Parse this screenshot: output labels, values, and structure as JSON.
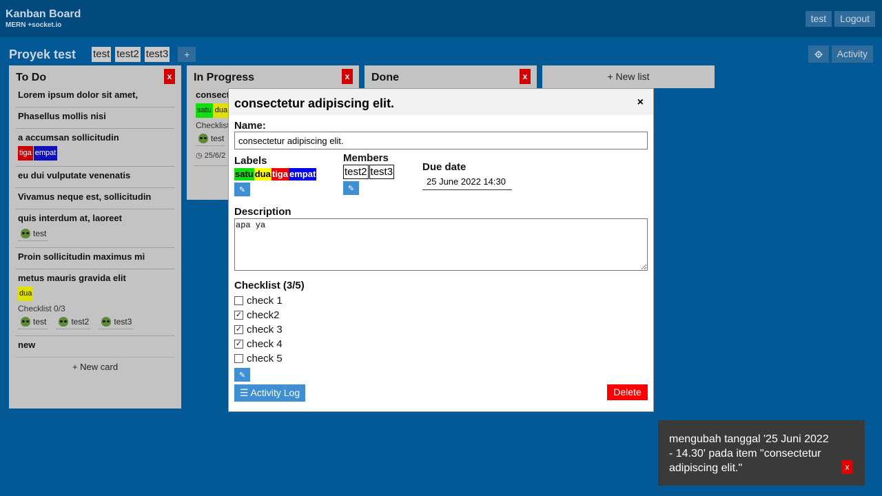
{
  "header": {
    "title": "Kanban Board",
    "subtitle": "MERN +socket.io",
    "user_label": "test",
    "logout_label": "Logout"
  },
  "project": {
    "title": "Proyek test",
    "tabs": [
      "test",
      "test2",
      "test3"
    ],
    "add_label": "+",
    "settings_icon": "gear-icon",
    "activity_label": "Activity"
  },
  "lists": [
    {
      "title": "To Do",
      "close_label": "x",
      "cards": [
        {
          "title": "Lorem ipsum dolor sit amet,"
        },
        {
          "title": "Phasellus mollis nisi"
        },
        {
          "title": "a accumsan sollicitudin",
          "labels": [
            "tiga",
            "empat"
          ]
        },
        {
          "title": "eu dui vulputate venenatis"
        },
        {
          "title": "Vivamus neque est, sollicitudin"
        },
        {
          "title": "quis interdum at, laoreet",
          "members": [
            "test"
          ]
        },
        {
          "title": "Proin sollicitudin maximus mi"
        },
        {
          "title": "metus mauris gravida elit",
          "labels": [
            "dua"
          ],
          "checklist": "Checklist 0/3",
          "members": [
            "test",
            "test2",
            "test3"
          ]
        },
        {
          "title": "new"
        }
      ],
      "new_card_label": "+ New card"
    },
    {
      "title": "In Progress",
      "close_label": "x",
      "card_title": "consect",
      "labels": [
        "satu",
        "dua"
      ],
      "checklist": "Checklist",
      "member": "test",
      "date": "25/6/2"
    },
    {
      "title": "Done",
      "close_label": "x"
    }
  ],
  "new_list_label": "+ New list",
  "modal": {
    "title": "consectetur adipiscing elit.",
    "close_label": "×",
    "name_label": "Name:",
    "name_value": "consectetur adipiscing elit.",
    "labels_label": "Labels",
    "labels": [
      "satu",
      "dua",
      "tiga",
      "empat"
    ],
    "members_label": "Members",
    "members": [
      "test2",
      "test3"
    ],
    "due_label": "Due date",
    "due_value": "25 June 2022 14:30",
    "description_label": "Description",
    "description_value": "apa ya",
    "checklist_label": "Checklist (3/5)",
    "checklist": [
      {
        "text": "check 1",
        "checked": false
      },
      {
        "text": "check2",
        "checked": true
      },
      {
        "text": "check 3",
        "checked": true
      },
      {
        "text": "check 4",
        "checked": true
      },
      {
        "text": "check 5",
        "checked": false
      }
    ],
    "activity_log_label": "☰ Activity Log",
    "delete_label": "Delete"
  },
  "toast": {
    "message": "mengubah tanggal '25 Juni 2022 - 14.30' pada item \"consectetur adipiscing elit.\"",
    "close_label": "x"
  },
  "colors": {
    "background": "#035896",
    "topbar": "#024a7e",
    "label_satu": "#11dd11",
    "label_dua": "#e0e000",
    "label_tiga": "#cc0000",
    "label_empat": "#1111bb",
    "delete": "#ff0000",
    "accent_button": "#3f8fd2"
  }
}
